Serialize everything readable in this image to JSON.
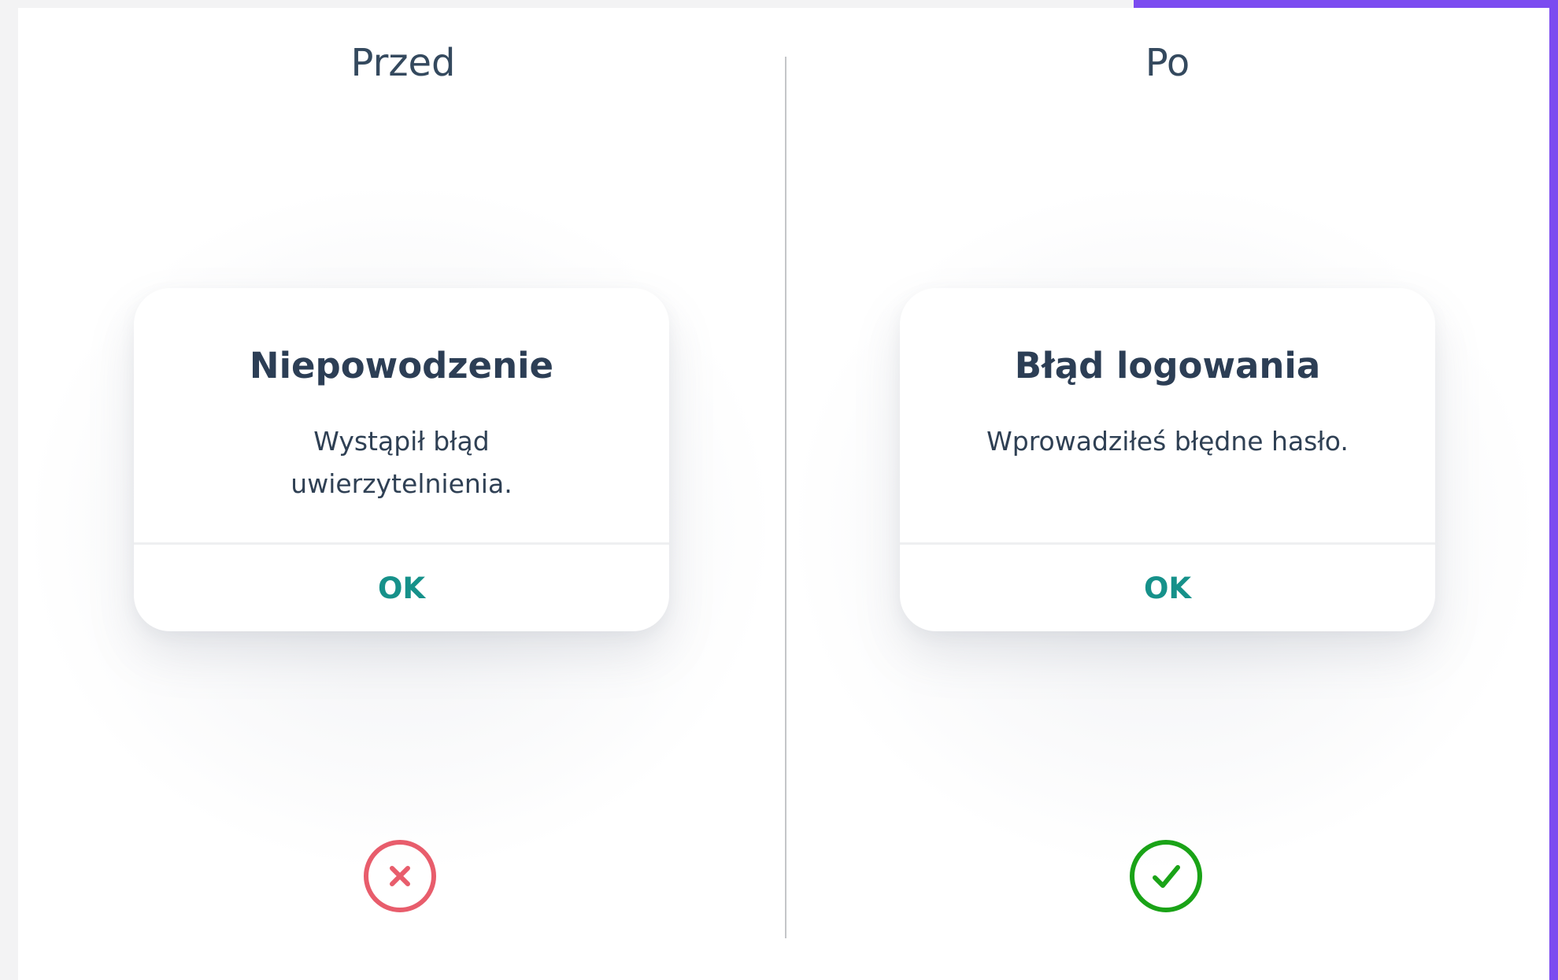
{
  "colors": {
    "accent": "#7b4bf0",
    "ok_button": "#16918a",
    "error": "#e85d6c",
    "success": "#1aa317"
  },
  "before": {
    "heading": "Przed",
    "dialog": {
      "title": "Niepowodzenie",
      "message": "Wystąpił błąd uwierzytelnienia.",
      "ok_label": "OK"
    },
    "status_icon": "error-x-circle-icon"
  },
  "after": {
    "heading": "Po",
    "dialog": {
      "title": "Błąd logowania",
      "message": "Wprowadziłeś błędne hasło.",
      "ok_label": "OK"
    },
    "status_icon": "success-check-circle-icon"
  }
}
